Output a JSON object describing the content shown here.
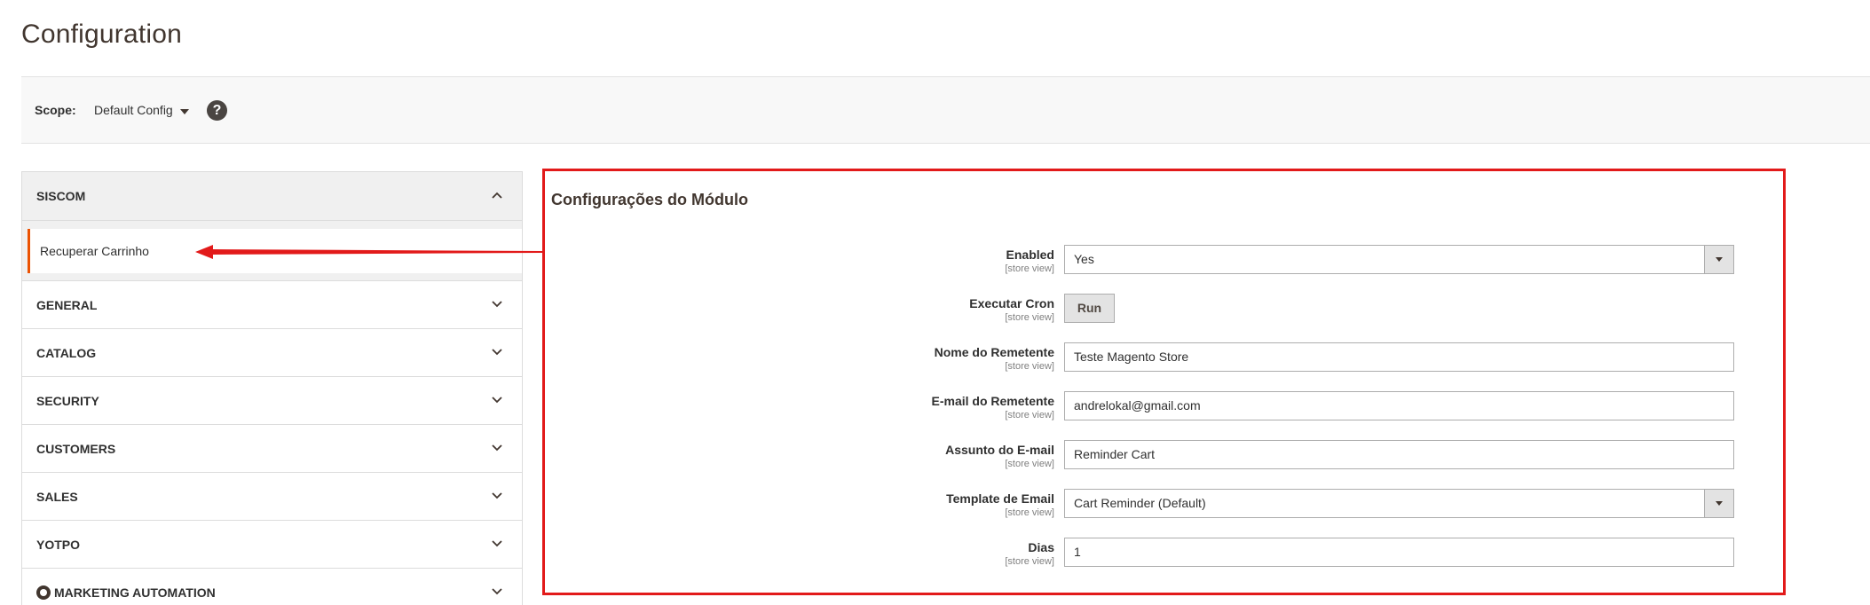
{
  "page": {
    "title": "Configuration"
  },
  "scope": {
    "label": "Scope:",
    "value": "Default Config",
    "help_symbol": "?"
  },
  "sidebar": {
    "sections": [
      {
        "label": "SISCOM",
        "expanded": true,
        "items": [
          {
            "label": "Recuperar Carrinho",
            "active": true
          }
        ]
      },
      {
        "label": "GENERAL",
        "expanded": false
      },
      {
        "label": "CATALOG",
        "expanded": false
      },
      {
        "label": "SECURITY",
        "expanded": false
      },
      {
        "label": "CUSTOMERS",
        "expanded": false
      },
      {
        "label": "SALES",
        "expanded": false
      },
      {
        "label": "YOTPO",
        "expanded": false
      },
      {
        "label": "MARKETING AUTOMATION",
        "expanded": false
      }
    ]
  },
  "config": {
    "title": "Configurações do Módulo",
    "fields": [
      {
        "label": "Enabled",
        "scope": "[store view]",
        "type": "select",
        "value": "Yes"
      },
      {
        "label": "Executar Cron",
        "scope": "[store view]",
        "type": "button",
        "value": "Run"
      },
      {
        "label": "Nome do Remetente",
        "scope": "[store view]",
        "type": "text",
        "value": "Teste Magento Store"
      },
      {
        "label": "E-mail do Remetente",
        "scope": "[store view]",
        "type": "text",
        "value": "andrelokal@gmail.com"
      },
      {
        "label": "Assunto do E-mail",
        "scope": "[store view]",
        "type": "text",
        "value": "Reminder Cart"
      },
      {
        "label": "Template de Email",
        "scope": "[store view]",
        "type": "select",
        "value": "Cart Reminder (Default)"
      },
      {
        "label": "Dias",
        "scope": "[store view]",
        "type": "text",
        "value": "1"
      }
    ]
  },
  "colors": {
    "accent_orange": "#eb5202",
    "highlight_red": "#e21a1a",
    "text_dark": "#303030",
    "title_brown": "#41362f"
  }
}
